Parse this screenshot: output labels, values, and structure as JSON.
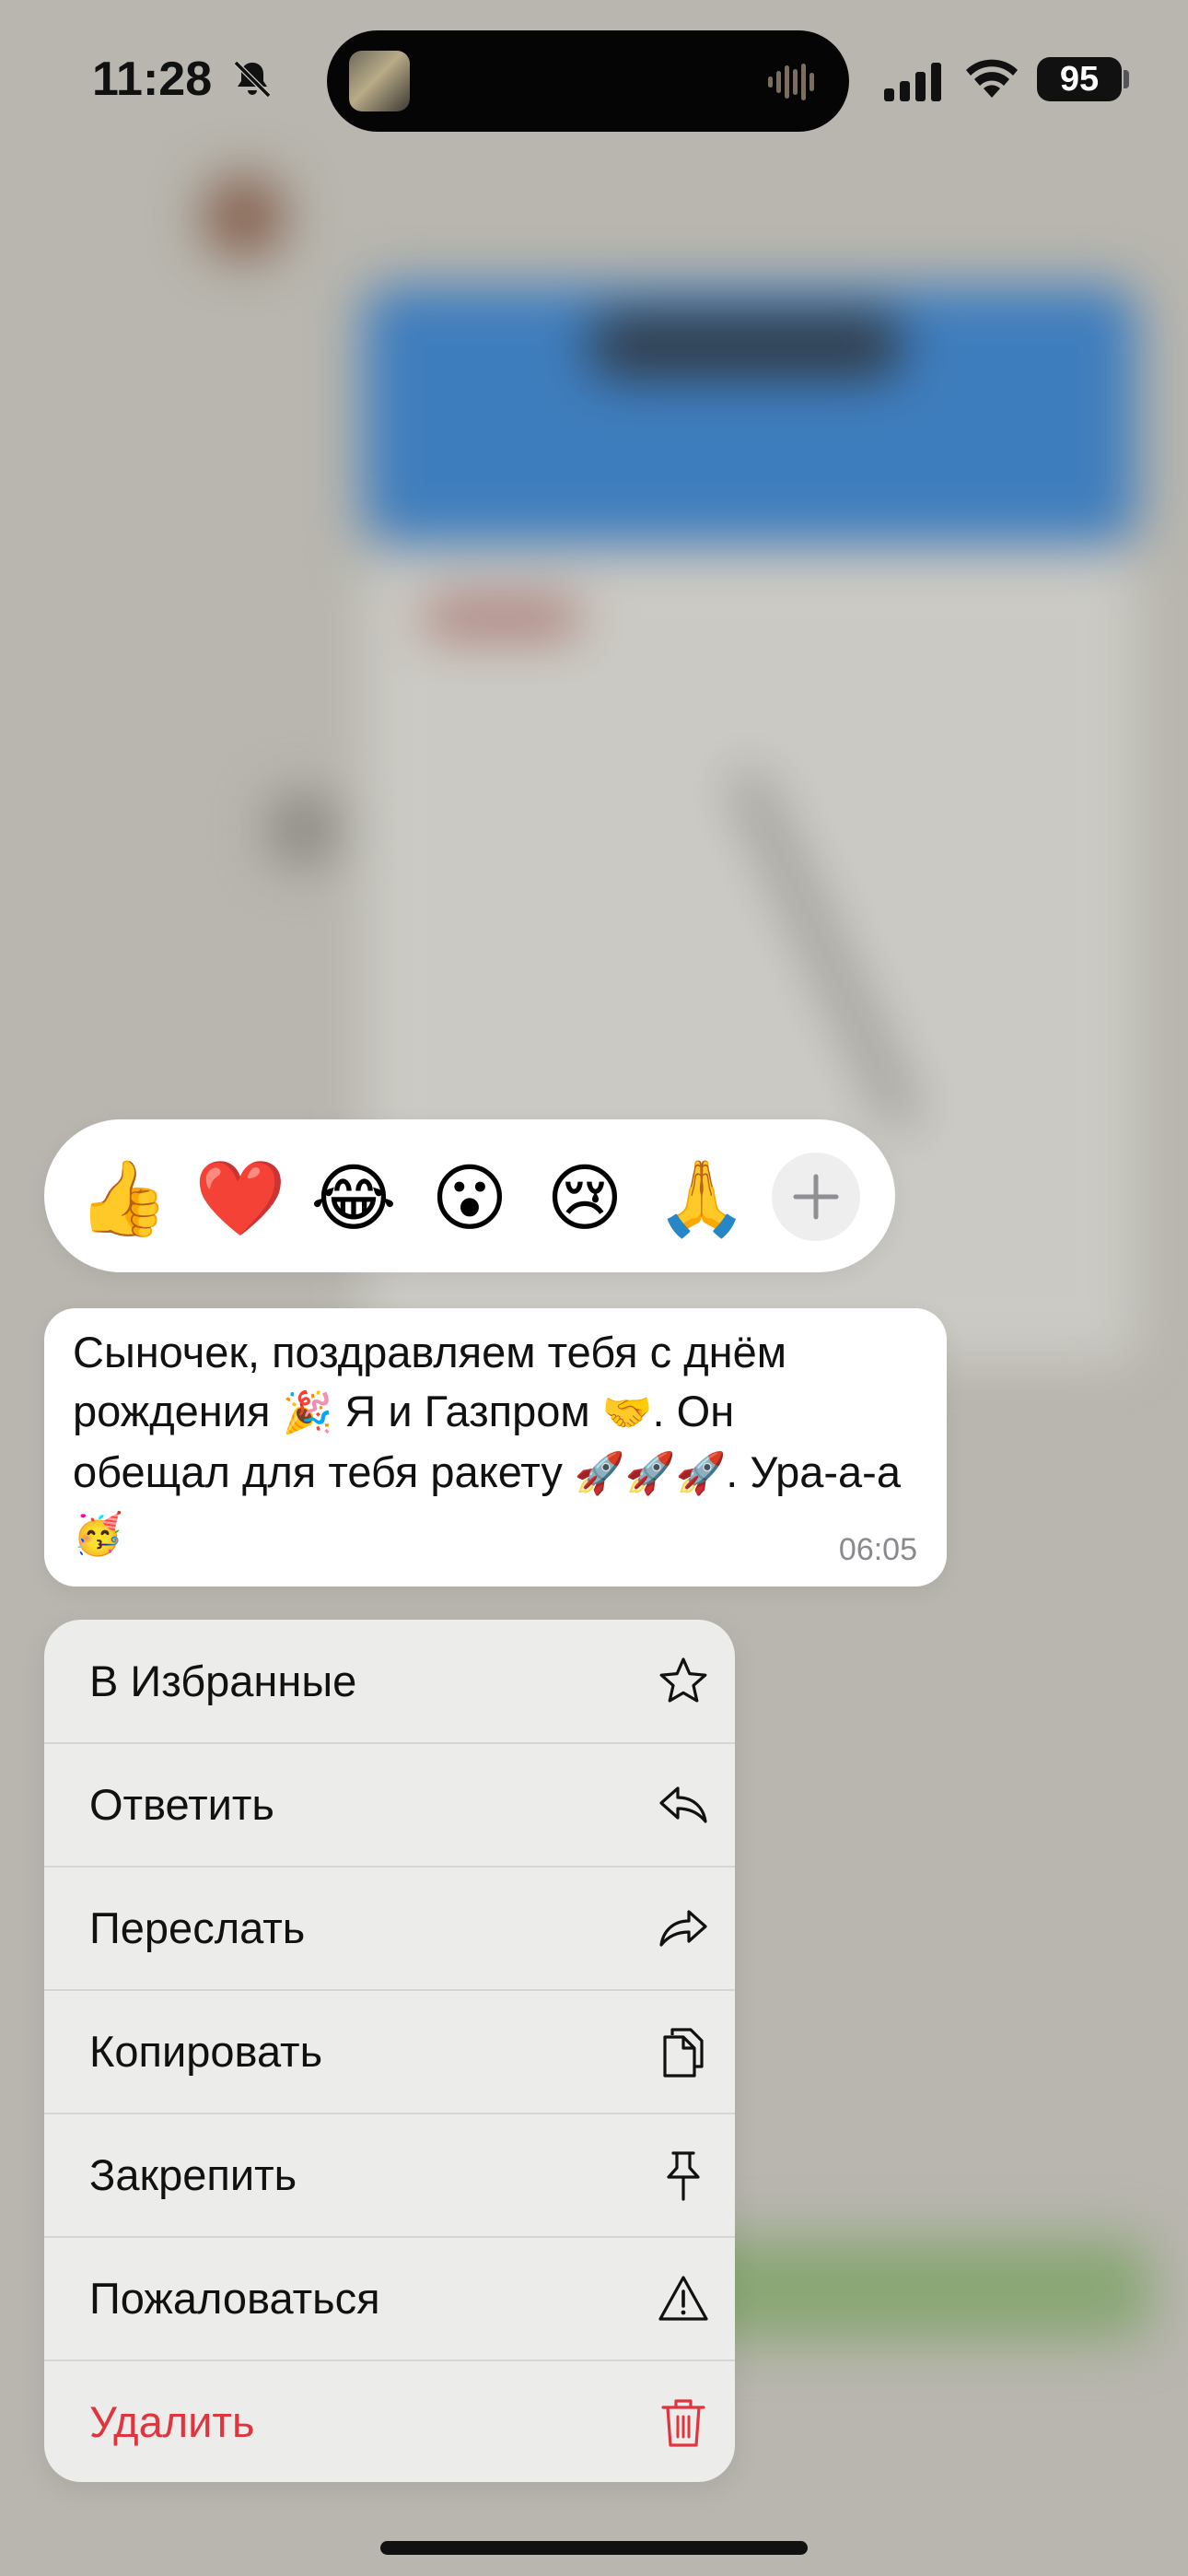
{
  "status_bar": {
    "time": "11:28",
    "battery": "95"
  },
  "reactions": {
    "emojis": [
      "👍",
      "❤️",
      "😂",
      "😮",
      "😢",
      "🙏"
    ],
    "add_icon": "plus-icon"
  },
  "message": {
    "parts": [
      "Сыночек, поздравляем тебя с днём рождения ",
      "🎉",
      " Я и Газпром ",
      "🤝",
      ". Он обещал для тебя ракету ",
      "🚀🚀🚀",
      ". Ура-а-а ",
      "🥳"
    ],
    "time": "06:05"
  },
  "menu": {
    "items": [
      {
        "label": "В Избранные",
        "icon": "star-icon"
      },
      {
        "label": "Ответить",
        "icon": "reply-icon"
      },
      {
        "label": "Переслать",
        "icon": "forward-icon"
      },
      {
        "label": "Копировать",
        "icon": "copy-icon"
      },
      {
        "label": "Закрепить",
        "icon": "pin-icon"
      },
      {
        "label": "Пожаловаться",
        "icon": "warning-icon"
      },
      {
        "label": "Удалить",
        "icon": "trash-icon"
      }
    ],
    "danger_color": "#e0353f"
  }
}
